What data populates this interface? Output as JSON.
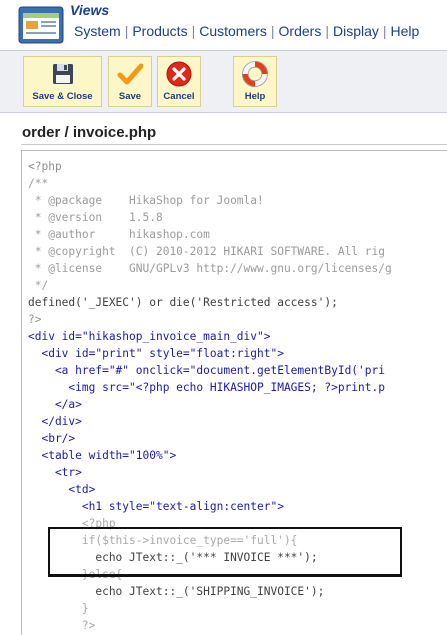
{
  "header": {
    "title": "Views",
    "menu": [
      "System",
      "Products",
      "Customers",
      "Orders",
      "Display",
      "Help"
    ]
  },
  "toolbar": {
    "buttons": [
      {
        "label": "Save & Close",
        "icon": "floppy-disk-icon"
      },
      {
        "label": "Save",
        "icon": "checkmark-icon"
      },
      {
        "label": "Cancel",
        "icon": "cancel-x-icon"
      },
      {
        "label": "Help",
        "icon": "lifebuoy-icon"
      }
    ]
  },
  "file": {
    "title": "order / invoice.php"
  },
  "code": {
    "lines": [
      "<?php",
      "/**",
      " * @package    HikaShop for Joomla!",
      " * @version    1.5.8",
      " * @author     hikashop.com",
      " * @copyright  (C) 2010-2012 HIKARI SOFTWARE. All rig",
      " * @license    GNU/GPLv3 http://www.gnu.org/licenses/g",
      " */",
      "defined('_JEXEC') or die('Restricted access');",
      "?>",
      "<div id=\"hikashop_invoice_main_div\">",
      "  <div id=\"print\" style=\"float:right\">",
      "    <a href=\"#\" onclick=\"document.getElementById('pri",
      "      <img src=\"<?php echo HIKASHOP_IMAGES; ?>print.p",
      "    </a>",
      "  </div>",
      "  <br/>",
      "  <table width=\"100%\">",
      "    <tr>",
      "      <td>",
      "        <h1 style=\"text-align:center\">",
      "        <?php",
      "        if($this->invoice_type=='full'){",
      "          echo JText::_('*** INVOICE ***');",
      "        }else{",
      "          echo JText::_('SHIPPING_INVOICE');",
      "        }",
      "        ?>"
    ]
  },
  "colors": {
    "menu_text": "#1a3f8a",
    "toolbar_button_bg": "#fcf7c9",
    "code_tag": "#1a1aa6",
    "code_string": "#0c7a0c",
    "code_comment": "#9b9b9b"
  }
}
